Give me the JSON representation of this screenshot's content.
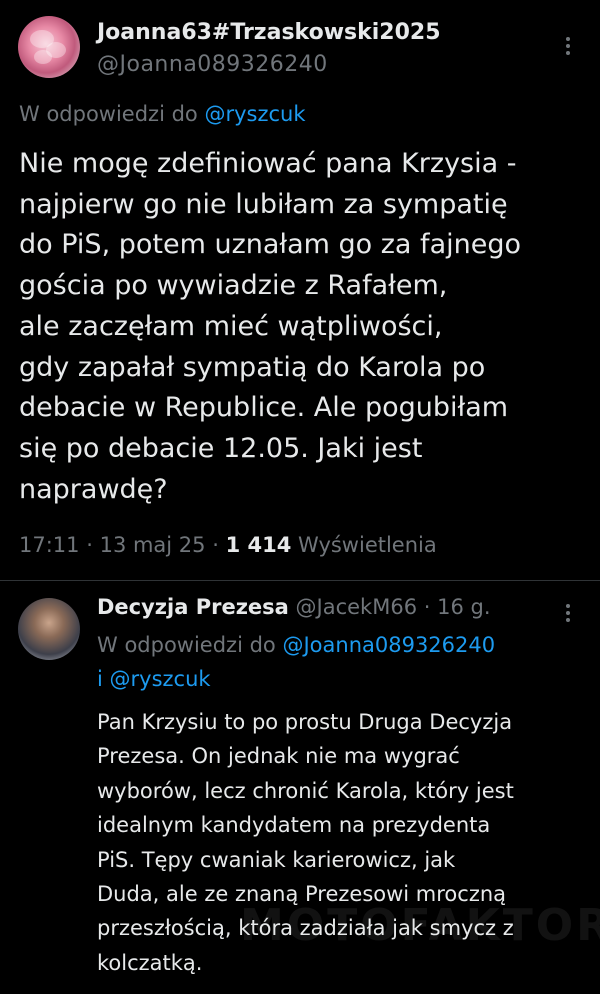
{
  "tweet": {
    "display_name": "Joanna63#Trzaskowski2025",
    "handle": "@Joanna089326240",
    "reply_prefix": "W odpowiedzi do",
    "reply_to": "@ryszcuk",
    "text_lines": [
      "Nie mogę zdefiniować pana Krzysia -",
      "najpierw go nie lubiłam za sympatię",
      "do PiS, potem uznałam go za fajnego",
      "gościa po wywiadzie z Rafałem,",
      "ale zaczęłam mieć wątpliwości,",
      "gdy zapałał sympatią do Karola po",
      "debacie w Republice. Ale pogubiłam",
      "się po debacie 12.05. Jaki jest",
      "naprawdę?"
    ],
    "time": "17:11",
    "date": "13 maj 25",
    "views_count": "1 414",
    "views_label": "Wyświetlenia"
  },
  "reply": {
    "display_name": "Decyzja Prezesa",
    "handle": "@JacekM66",
    "age": "16 g.",
    "reply_prefix": "W odpowiedzi do",
    "reply_to_1": "@Joanna089326240",
    "reply_and": "i",
    "reply_to_2": "@ryszcuk",
    "text_lines": [
      "Pan Krzysiu to po prostu Druga Decyzja",
      "Prezesa. On jednak nie ma wygrać",
      "wyborów, lecz chronić Karola, który jest",
      "idealnym kandydatem na prezydenta",
      "PiS. Tępy cwaniak karierowicz, jak",
      "Duda, ale ze znaną Prezesowi mroczną",
      "przeszłością, która zadziała jak smycz z",
      "kolczatką."
    ]
  },
  "watermark": "MOTOFAKTOR",
  "colors": {
    "background": "#000000",
    "text": "#e7e9ea",
    "muted": "#71767b",
    "link": "#1d9bf0"
  },
  "icons": {
    "more": "more-vertical-icon"
  }
}
